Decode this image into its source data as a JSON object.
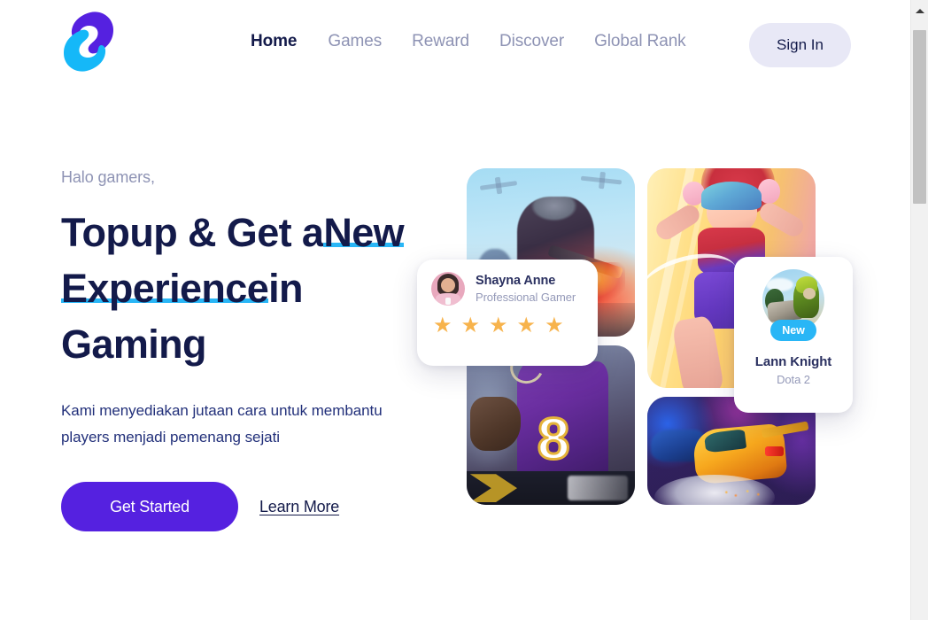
{
  "header": {
    "logo_name": "sparq-logo",
    "nav": [
      {
        "label": "Home",
        "active": true
      },
      {
        "label": "Games",
        "active": false
      },
      {
        "label": "Reward",
        "active": false
      },
      {
        "label": "Discover",
        "active": false
      },
      {
        "label": "Global Rank",
        "active": false
      }
    ],
    "signin_label": "Sign In"
  },
  "hero": {
    "eyebrow": "Halo gamers,",
    "headline_part1": "Topup & Get a",
    "headline_highlight": "New Experience",
    "headline_part2": "in Gaming",
    "subtext_line1": "Kami menyediakan jutaan cara untuk membantu",
    "subtext_line2": "players menjadi pemenang sejati",
    "primary_cta": "Get Started",
    "secondary_cta": "Learn More"
  },
  "testimonial": {
    "name": "Shayna Anne",
    "role": "Professional Gamer",
    "rating": 5,
    "star_glyph": "★",
    "avatar_name": "shayna-anne-avatar"
  },
  "game_card": {
    "badge": "New",
    "title": "Lann Knight",
    "subtitle": "Dota 2",
    "avatar_name": "lann-knight-avatar"
  },
  "collage": [
    {
      "name": "game-tile-shooter",
      "alt": "first person shooter artwork"
    },
    {
      "name": "game-tile-cartoon",
      "alt": "cartoon battle royale character artwork"
    },
    {
      "name": "game-tile-football",
      "alt": "american football player artwork"
    },
    {
      "name": "game-tile-racing",
      "alt": "neon street racing artwork"
    }
  ],
  "colors": {
    "brand_purple": "#5521e0",
    "brand_cyan": "#29b6f6",
    "navy": "#131a4a",
    "muted": "#8e93b4",
    "star_amber": "#f7b34c",
    "signin_bg": "#e8e8f6"
  },
  "scrollbar": {
    "up_arrow": "scroll-up-arrow",
    "thumb": "scroll-thumb"
  }
}
